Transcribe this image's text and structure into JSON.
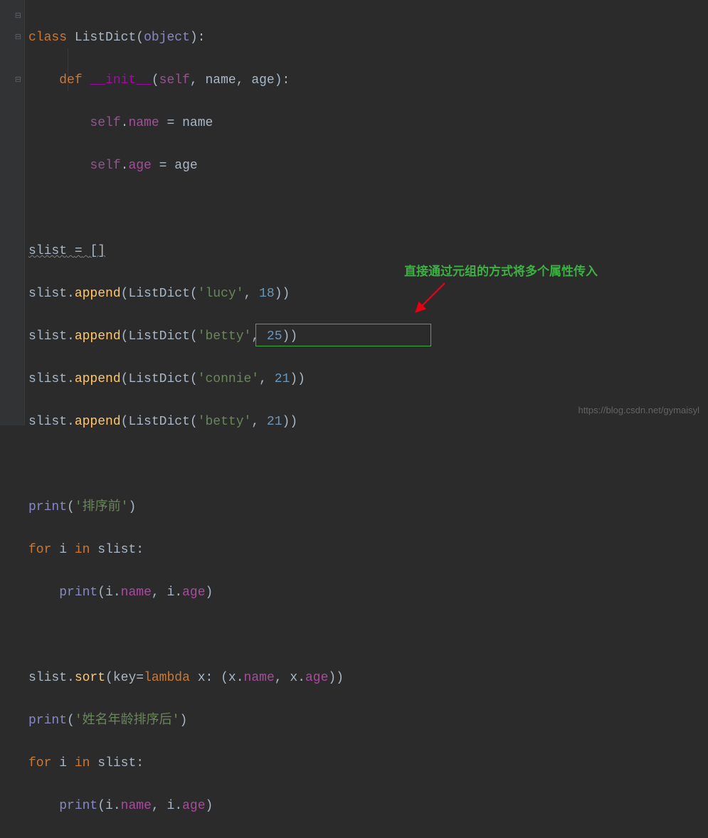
{
  "code": {
    "class_kw": "class",
    "class_name": "ListDict",
    "object": "object",
    "def_kw": "def",
    "init": "__init__",
    "self": "self",
    "name_param": "name",
    "age_param": "age",
    "self_name": "self",
    "name_attr": "name",
    "eq": "=",
    "self_age": "self",
    "age_attr": "age",
    "slist": "slist",
    "empty_list": "[]",
    "append": "append",
    "listdict": "ListDict",
    "lucy": "'lucy'",
    "n18": "18",
    "betty": "'betty'",
    "n25": "25",
    "connie": "'connie'",
    "n21": "21",
    "betty2": "'betty'",
    "n21b": "21",
    "print": "print",
    "before_sort": "'排序前'",
    "for_kw": "for",
    "i_var": "i",
    "in_kw": "in",
    "i_name": "name",
    "i_age": "age",
    "sort": "sort",
    "key": "key",
    "lambda_kw": "lambda",
    "x_var": "x",
    "x_name": "name",
    "x_age": "age",
    "after_sort": "'姓名年龄排序后'"
  },
  "annotation": {
    "text": "直接通过元组的方式将多个属性传入"
  },
  "watermark": "https://blog.csdn.net/gymaisyl",
  "fold": {
    "m1": "⊟",
    "m2": "⊟",
    "m3": "⊟"
  }
}
